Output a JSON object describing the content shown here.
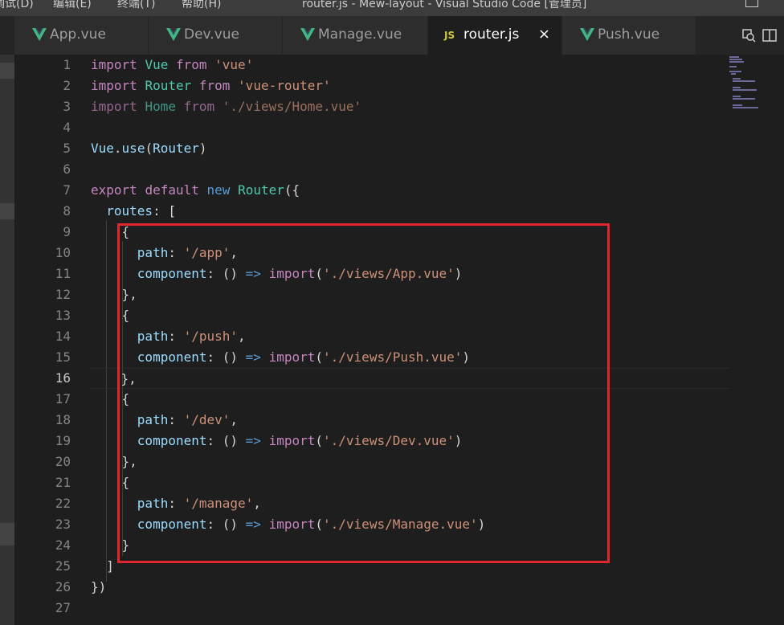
{
  "titlebar": {
    "menu": [
      "调试(D)",
      "编辑(E)",
      "终端(T)",
      "帮助(H)"
    ],
    "title": "router.js - Mew-layout - Visual Studio Code [管理员]"
  },
  "tabs": [
    {
      "label": "App.vue",
      "icon": "vue-icon",
      "active": false
    },
    {
      "label": "Dev.vue",
      "icon": "vue-icon",
      "active": false
    },
    {
      "label": "Manage.vue",
      "icon": "vue-icon",
      "active": false
    },
    {
      "label": "router.js",
      "icon": "js-icon",
      "badge": "JS",
      "active": true,
      "close": "×"
    },
    {
      "label": "Push.vue",
      "icon": "vue-icon",
      "active": false
    }
  ],
  "tab_actions": [
    "open-changes-icon",
    "split-editor-icon"
  ],
  "colors": {
    "keyword": "#c586c0",
    "storage": "#569cd6",
    "class": "#4ec9b0",
    "string": "#ce9178",
    "property": "#9cdcfe",
    "highlight_box": "#e0272f",
    "vue_green": "#41b883",
    "js_yellow": "#cbcb41"
  },
  "editor": {
    "active_line": 16,
    "line_numbers": [
      "1",
      "2",
      "3",
      "4",
      "5",
      "6",
      "7",
      "8",
      "9",
      "10",
      "11",
      "12",
      "13",
      "14",
      "15",
      "16",
      "17",
      "18",
      "19",
      "20",
      "21",
      "22",
      "23",
      "24",
      "25",
      "26",
      "27"
    ],
    "lines": [
      {
        "n": 1,
        "tokens": [
          [
            "kw",
            "import"
          ],
          [
            "plain",
            " "
          ],
          [
            "cls",
            "Vue"
          ],
          [
            "plain",
            " "
          ],
          [
            "kw",
            "from"
          ],
          [
            "plain",
            " "
          ],
          [
            "str",
            "'vue'"
          ]
        ]
      },
      {
        "n": 2,
        "tokens": [
          [
            "kw",
            "import"
          ],
          [
            "plain",
            " "
          ],
          [
            "cls",
            "Router"
          ],
          [
            "plain",
            " "
          ],
          [
            "kw",
            "from"
          ],
          [
            "plain",
            " "
          ],
          [
            "str",
            "'vue-router'"
          ]
        ]
      },
      {
        "n": 3,
        "faded": true,
        "tokens": [
          [
            "kw",
            "import"
          ],
          [
            "plain",
            " "
          ],
          [
            "cls",
            "Home"
          ],
          [
            "plain",
            " "
          ],
          [
            "kw",
            "from"
          ],
          [
            "plain",
            " "
          ],
          [
            "str",
            "'./views/Home.vue'"
          ]
        ]
      },
      {
        "n": 4,
        "tokens": []
      },
      {
        "n": 5,
        "tokens": [
          [
            "prop",
            "Vue"
          ],
          [
            "plain",
            "."
          ],
          [
            "prop",
            "use"
          ],
          [
            "plain",
            "("
          ],
          [
            "prop",
            "Router"
          ],
          [
            "plain",
            ")"
          ]
        ]
      },
      {
        "n": 6,
        "tokens": []
      },
      {
        "n": 7,
        "tokens": [
          [
            "kw",
            "export"
          ],
          [
            "plain",
            " "
          ],
          [
            "kw",
            "default"
          ],
          [
            "plain",
            " "
          ],
          [
            "kw2",
            "new"
          ],
          [
            "plain",
            " "
          ],
          [
            "cls",
            "Router"
          ],
          [
            "plain",
            "({"
          ]
        ]
      },
      {
        "n": 8,
        "tokens": [
          [
            "plain",
            "  "
          ],
          [
            "prop",
            "routes"
          ],
          [
            "plain",
            ": ["
          ]
        ]
      },
      {
        "n": 9,
        "tokens": [
          [
            "plain",
            "    {"
          ]
        ]
      },
      {
        "n": 10,
        "tokens": [
          [
            "plain",
            "      "
          ],
          [
            "prop",
            "path"
          ],
          [
            "plain",
            ": "
          ],
          [
            "str",
            "'/app'"
          ],
          [
            "plain",
            ","
          ]
        ]
      },
      {
        "n": 11,
        "tokens": [
          [
            "plain",
            "      "
          ],
          [
            "prop",
            "component"
          ],
          [
            "plain",
            ": () "
          ],
          [
            "kw2",
            "=>"
          ],
          [
            "plain",
            " "
          ],
          [
            "kw",
            "import"
          ],
          [
            "plain",
            "("
          ],
          [
            "str",
            "'./views/App.vue'"
          ],
          [
            "plain",
            ")"
          ]
        ]
      },
      {
        "n": 12,
        "tokens": [
          [
            "plain",
            "    },"
          ]
        ]
      },
      {
        "n": 13,
        "tokens": [
          [
            "plain",
            "    {"
          ]
        ]
      },
      {
        "n": 14,
        "tokens": [
          [
            "plain",
            "      "
          ],
          [
            "prop",
            "path"
          ],
          [
            "plain",
            ": "
          ],
          [
            "str",
            "'/push'"
          ],
          [
            "plain",
            ","
          ]
        ]
      },
      {
        "n": 15,
        "tokens": [
          [
            "plain",
            "      "
          ],
          [
            "prop",
            "component"
          ],
          [
            "plain",
            ": () "
          ],
          [
            "kw2",
            "=>"
          ],
          [
            "plain",
            " "
          ],
          [
            "kw",
            "import"
          ],
          [
            "plain",
            "("
          ],
          [
            "str",
            "'./views/Push.vue'"
          ],
          [
            "plain",
            ")"
          ]
        ]
      },
      {
        "n": 16,
        "tokens": [
          [
            "plain",
            "    },"
          ]
        ]
      },
      {
        "n": 17,
        "tokens": [
          [
            "plain",
            "    {"
          ]
        ]
      },
      {
        "n": 18,
        "tokens": [
          [
            "plain",
            "      "
          ],
          [
            "prop",
            "path"
          ],
          [
            "plain",
            ": "
          ],
          [
            "str",
            "'/dev'"
          ],
          [
            "plain",
            ","
          ]
        ]
      },
      {
        "n": 19,
        "tokens": [
          [
            "plain",
            "      "
          ],
          [
            "prop",
            "component"
          ],
          [
            "plain",
            ": () "
          ],
          [
            "kw2",
            "=>"
          ],
          [
            "plain",
            " "
          ],
          [
            "kw",
            "import"
          ],
          [
            "plain",
            "("
          ],
          [
            "str",
            "'./views/Dev.vue'"
          ],
          [
            "plain",
            ")"
          ]
        ]
      },
      {
        "n": 20,
        "tokens": [
          [
            "plain",
            "    },"
          ]
        ]
      },
      {
        "n": 21,
        "tokens": [
          [
            "plain",
            "    {"
          ]
        ]
      },
      {
        "n": 22,
        "tokens": [
          [
            "plain",
            "      "
          ],
          [
            "prop",
            "path"
          ],
          [
            "plain",
            ": "
          ],
          [
            "str",
            "'/manage'"
          ],
          [
            "plain",
            ","
          ]
        ]
      },
      {
        "n": 23,
        "tokens": [
          [
            "plain",
            "      "
          ],
          [
            "prop",
            "component"
          ],
          [
            "plain",
            ": () "
          ],
          [
            "kw2",
            "=>"
          ],
          [
            "plain",
            " "
          ],
          [
            "kw",
            "import"
          ],
          [
            "plain",
            "("
          ],
          [
            "str",
            "'./views/Manage.vue'"
          ],
          [
            "plain",
            ")"
          ]
        ]
      },
      {
        "n": 24,
        "tokens": [
          [
            "plain",
            "    }"
          ]
        ]
      },
      {
        "n": 25,
        "tokens": [
          [
            "plain",
            "  ]"
          ]
        ]
      },
      {
        "n": 26,
        "tokens": [
          [
            "plain",
            "})"
          ]
        ]
      },
      {
        "n": 27,
        "tokens": []
      }
    ]
  }
}
